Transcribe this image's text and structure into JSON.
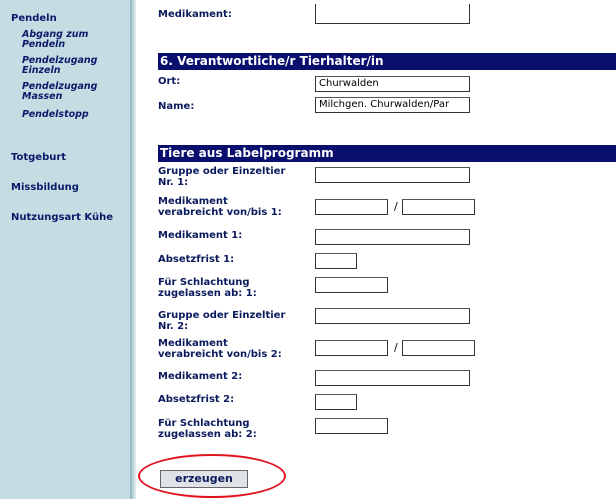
{
  "sidebar": {
    "pendeln": "Pendeln",
    "sub1_line1": "Abgang zum",
    "sub1_line2": "Pendeln",
    "sub2_line1": "Pendelzugang",
    "sub2_line2": "Einzeln",
    "sub3_line1": "Pendelzugang",
    "sub3_line2": "Massen",
    "sub4": "Pendelstopp",
    "totgeburt": "Totgeburt",
    "missbildung": "Missbildung",
    "nutzungsart": "Nutzungsart Kühe"
  },
  "form": {
    "medikament_label": "Medikament:",
    "section6_title": "6. Verantwortliche/r Tierhalter/in",
    "ort_label": "Ort:",
    "ort_value": "Churwalden",
    "name_label": "Name:",
    "name_value": "Milchgen. Churwalden/Par",
    "labelprogramm_title": "Tiere aus Labelprogramm",
    "gruppe1_l1": "Gruppe oder Einzeltier",
    "gruppe1_l2": "Nr. 1:",
    "med_verab1_l1": "Medikament",
    "med_verab1_l2": "verabreicht von/bis 1:",
    "medikament1": "Medikament 1:",
    "absetzfrist1": "Absetzfrist 1:",
    "schlacht1_l1": "Für Schlachtung",
    "schlacht1_l2": "zugelassen ab: 1:",
    "gruppe2_l1": "Gruppe oder Einzeltier",
    "gruppe2_l2": "Nr. 2:",
    "med_verab2_l1": "Medikament",
    "med_verab2_l2": "verabreicht von/bis 2:",
    "medikament2": "Medikament 2:",
    "absetzfrist2": "Absetzfrist 2:",
    "schlacht2_l1": "Für Schlachtung",
    "schlacht2_l2": "zugelassen ab: 2:",
    "slash": "/",
    "submit_label": "erzeugen"
  },
  "colors": {
    "sidebar_bg": "#c4dde3",
    "header_bar": "#0a0f6e",
    "label_text": "#0a1a5c",
    "highlight_ring": "#e0141e"
  }
}
